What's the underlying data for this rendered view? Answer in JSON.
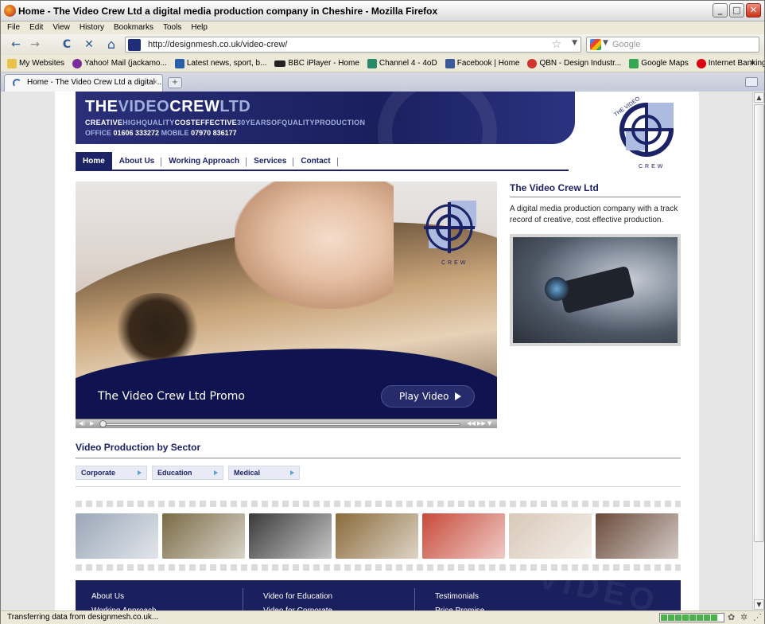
{
  "window": {
    "title": "Home - The Video Crew Ltd a digital media production company in Cheshire - Mozilla Firefox",
    "controls": {
      "minimize": "_",
      "maximize": "□",
      "close": "✕"
    }
  },
  "menu": [
    "File",
    "Edit",
    "View",
    "History",
    "Bookmarks",
    "Tools",
    "Help"
  ],
  "navbar": {
    "back": "←",
    "forward": "→",
    "reload": "C",
    "stop": "✕",
    "home": "⌂",
    "url": "http://designmesh.co.uk/video-crew/",
    "star": "☆",
    "search_placeholder": "Google"
  },
  "bookmarks": [
    {
      "label": "My Websites",
      "color": "#e8c24a"
    },
    {
      "label": "Yahoo! Mail (jackamo...",
      "color": "#7a2c9a"
    },
    {
      "label": "Latest news, sport, b...",
      "color": "#2a5fa8"
    },
    {
      "label": "BBC iPlayer - Home",
      "color": "#222222"
    },
    {
      "label": "Channel 4 - 4oD",
      "color": "#2a8a6a"
    },
    {
      "label": "Facebook | Home",
      "color": "#3b5998"
    },
    {
      "label": "QBN - Design Industr...",
      "color": "#d0342c"
    },
    {
      "label": "Google Maps",
      "color": "#34a853"
    },
    {
      "label": "Internet Banking: HS...",
      "color": "#db0011"
    }
  ],
  "bookmarks_more": "»",
  "tab": {
    "label": "Home - The Video Crew Ltd a digital ...",
    "close": "×",
    "new": "+"
  },
  "status": {
    "text": "Transferring data from designmesh.co.uk..."
  },
  "site": {
    "brand_bold": "THE",
    "brand_light": "VIDEO",
    "brand_bold2": "CREW",
    "brand_light2": "LTD",
    "tag_a": "CREATIVE",
    "tag_b": "HIGHQUALITY",
    "tag_c": "COSTEFFECTIVE",
    "tag_d": "30YEARSOFQUALITYPRODUCTION",
    "office_label": "OFFICE ",
    "office_number": "01606 333272",
    "mobile_label": " MOBILE ",
    "mobile_number": "07970 836177",
    "logo_text": "THE VIDEO",
    "logo_crew": "CREW",
    "nav": [
      "Home",
      "About Us",
      "Working Approach",
      "Services",
      "Contact"
    ],
    "hero_caption": "The Video Crew Ltd Promo",
    "hero_button": "Play Video",
    "side_heading": "The Video Crew Ltd",
    "side_text": "A digital media production company with a track record of creative, cost effective production.",
    "sector_heading": "Video Production by Sector",
    "sectors": [
      "Corporate",
      "Education",
      "Medical"
    ],
    "footer": {
      "col1": [
        "About Us",
        "Working Approach"
      ],
      "col2": [
        "Video for Education",
        "Video for Corporate"
      ],
      "col3": [
        "Testimonials",
        "Price Promise"
      ],
      "watermark": "VIDEO"
    }
  },
  "film_frames": [
    {
      "name": "frame-presenter",
      "color": "#9aa7b8"
    },
    {
      "name": "frame-interview",
      "color": "#7a6b45"
    },
    {
      "name": "frame-camera",
      "color": "#3a3a3a"
    },
    {
      "name": "frame-crew",
      "color": "#8a6a3a"
    },
    {
      "name": "frame-puppet",
      "color": "#c84a3a"
    },
    {
      "name": "frame-clapper",
      "color": "#d8c8b8"
    },
    {
      "name": "frame-outdoor",
      "color": "#6a4a3a"
    }
  ],
  "colors": {
    "navy": "#1c2266",
    "accent": "#5aa0d6"
  }
}
